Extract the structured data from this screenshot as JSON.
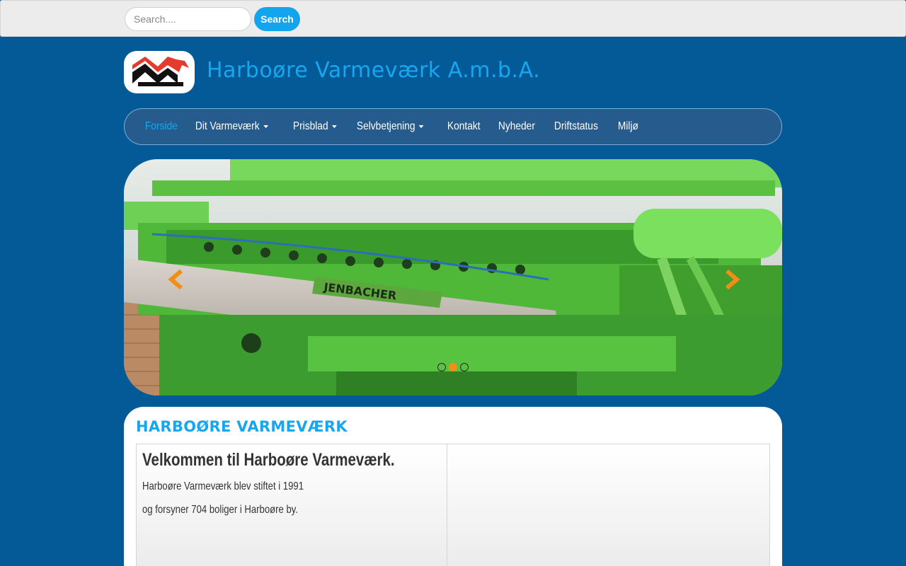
{
  "search": {
    "placeholder": "Search....",
    "button_label": "Search"
  },
  "header": {
    "site_title": "Harboøre Varmeværk A.m.b.A.",
    "logo_icon": "company-logo"
  },
  "nav": {
    "items": [
      {
        "label": "Forside",
        "active": true,
        "dropdown": false
      },
      {
        "label": "Dit Varmeværk",
        "active": false,
        "dropdown": true
      },
      {
        "label": "Prisblad",
        "active": false,
        "dropdown": true
      },
      {
        "label": "Selvbetjening",
        "active": false,
        "dropdown": true
      },
      {
        "label": "Kontakt",
        "active": false,
        "dropdown": false
      },
      {
        "label": "Nyheder",
        "active": false,
        "dropdown": false
      },
      {
        "label": "Driftstatus",
        "active": false,
        "dropdown": false
      },
      {
        "label": "Miljø",
        "active": false,
        "dropdown": false
      }
    ]
  },
  "carousel": {
    "slide_count": 3,
    "active_index": 1,
    "prev_icon": "chevron-left-icon",
    "next_icon": "chevron-right-icon",
    "slide_text": "JENBACHER"
  },
  "content": {
    "heading": "HARBOØRE VARMEVÆRK",
    "welcome_title": "Velkommen til Harboøre Varmeværk.",
    "line1": "Harboøre Varmeværk blev stiftet i 1991",
    "line2": "og forsyner 704 boliger i Harboøre by."
  },
  "colors": {
    "page_background": "#045a96",
    "accent": "#17a6f0",
    "nav_background": "#255c8d",
    "indicator_active": "#f28d16"
  }
}
